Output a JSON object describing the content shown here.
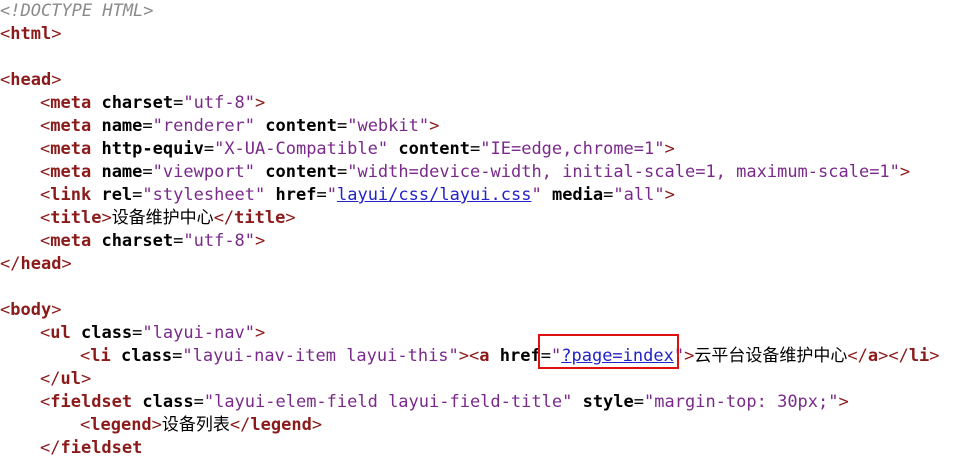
{
  "doctype": "<!DOCTYPE HTML>",
  "lines": {
    "html_open": "html",
    "head_open": "head",
    "meta1": {
      "tag": "meta",
      "a1": "charset",
      "v1": "utf-8"
    },
    "meta2": {
      "tag": "meta",
      "a1": "name",
      "v1": "renderer",
      "a2": "content",
      "v2": "webkit"
    },
    "meta3": {
      "tag": "meta",
      "a1": "http-equiv",
      "v1": "X-UA-Compatible",
      "a2": "content",
      "v2": "IE=edge,chrome=1"
    },
    "meta4": {
      "tag": "meta",
      "a1": "name",
      "v1": "viewport",
      "a2": "content",
      "v2": "width=device-width, initial-scale=1, maximum-scale=1"
    },
    "link": {
      "tag": "link",
      "a1": "rel",
      "v1": "stylesheet",
      "a2": "href",
      "v2": "layui/css/layui.css",
      "a3": "media",
      "v3": "all"
    },
    "title": {
      "tag": "title",
      "text": "设备维护中心"
    },
    "meta5": {
      "tag": "meta",
      "a1": "charset",
      "v1": "utf-8"
    },
    "head_close": "head",
    "body_open": "body",
    "ul": {
      "tag": "ul",
      "a1": "class",
      "v1": "layui-nav"
    },
    "li": {
      "tag": "li",
      "a1": "class",
      "v1": "layui-nav-item layui-this",
      "a_tag": "a",
      "a_attr": "href",
      "a_val": "?page=index",
      "text": "云平台设备维护中心"
    },
    "ul_close": "ul",
    "fieldset": {
      "tag": "fieldset",
      "a1": "class",
      "v1": "layui-elem-field layui-field-title",
      "a2": "style",
      "v2": "margin-top: 30px;"
    },
    "legend": {
      "tag": "legend",
      "text": "设备列表"
    },
    "fieldset_close": "fieldset"
  },
  "colors": {
    "tag": "#8b1a1a",
    "value": "#7a2a8a",
    "link": "#2222c8",
    "doctype": "#8a8a8a",
    "highlight": "#e01010"
  }
}
